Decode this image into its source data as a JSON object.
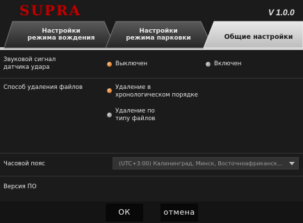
{
  "header": {
    "logo": "SUPRA",
    "version_prefix": "V",
    "version_number": "1.0.0"
  },
  "tabs": [
    {
      "label_line1": "Настройки",
      "label_line2": "режима вождения",
      "active": false
    },
    {
      "label_line1": "Настройки",
      "label_line2": "режима парковки",
      "active": false
    },
    {
      "label": "Общие настройки",
      "active": true
    }
  ],
  "settings": {
    "shock_sound": {
      "label_line1": "Звуковой сигнал",
      "label_line2": "датчика удара",
      "options": [
        {
          "label": "Выключен",
          "selected": true
        },
        {
          "label": "Включен",
          "selected": false
        }
      ]
    },
    "file_delete": {
      "label": "Способ удаления файлов",
      "options": [
        {
          "line1": "Удаление в",
          "line2": "хронологическом порядке",
          "selected": true
        },
        {
          "line1": "Удаление по",
          "line2": "типу файлов",
          "selected": false
        }
      ]
    },
    "timezone": {
      "label": "Часовой пояс",
      "value": "(UTC+3:00) Калининград, Минск, Восточноафриканск..."
    },
    "firmware": {
      "label": "Версия ПО"
    }
  },
  "buttons": {
    "ok": "ОК",
    "cancel": "отмена"
  },
  "colors": {
    "accent": "#e88a3a",
    "logo": "#c00000",
    "background": "#1b1b1b",
    "active_tab": "#d6d6d6"
  }
}
